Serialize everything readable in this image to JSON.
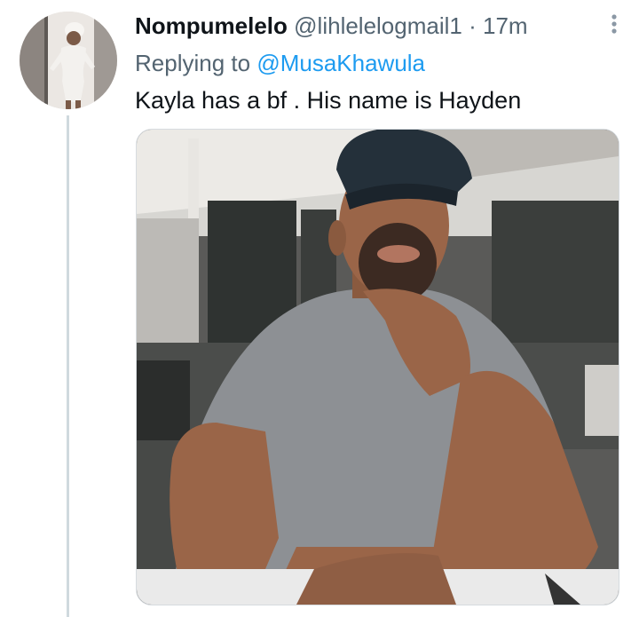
{
  "tweet": {
    "display_name": "Nompumelelo",
    "handle": "@lihlelelogmail1",
    "separator": "·",
    "time": "17m",
    "replying_prefix": "Replying to",
    "replying_to": "@MusaKhawula",
    "text": "Kayla has a bf . His name is Hayden"
  },
  "icons": {
    "more": "more-vertical-icon"
  },
  "colors": {
    "name": "#0f1419",
    "secondary": "#536471",
    "link": "#1d9bf0",
    "thread_line": "#cfd9de"
  }
}
